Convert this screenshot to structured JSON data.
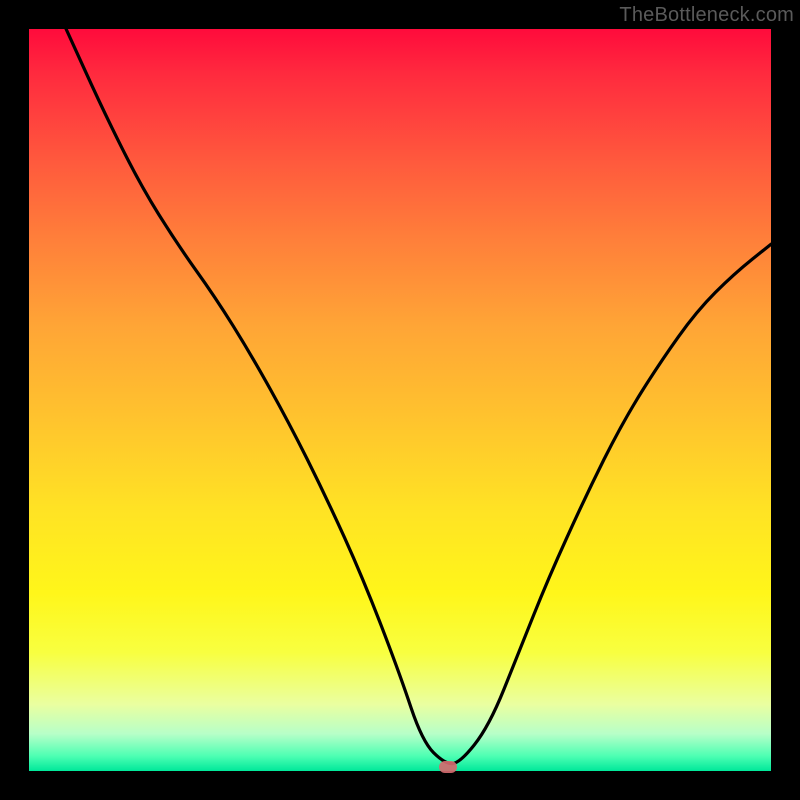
{
  "watermark": "TheBottleneck.com",
  "chart_data": {
    "type": "line",
    "title": "",
    "xlabel": "",
    "ylabel": "",
    "xlim": [
      0,
      1
    ],
    "ylim": [
      0,
      1
    ],
    "series": [
      {
        "name": "curve",
        "x": [
          0.05,
          0.1,
          0.15,
          0.2,
          0.25,
          0.3,
          0.35,
          0.4,
          0.45,
          0.5,
          0.53,
          0.56,
          0.58,
          0.62,
          0.66,
          0.7,
          0.75,
          0.8,
          0.85,
          0.9,
          0.95,
          1.0
        ],
        "y": [
          1.0,
          0.89,
          0.79,
          0.71,
          0.64,
          0.56,
          0.47,
          0.37,
          0.26,
          0.13,
          0.04,
          0.01,
          0.01,
          0.06,
          0.16,
          0.26,
          0.37,
          0.47,
          0.55,
          0.62,
          0.67,
          0.71
        ]
      }
    ],
    "marker": {
      "x": 0.565,
      "y": 0.005
    },
    "colors": {
      "curve": "#000000",
      "marker": "#d46a6f",
      "gradient_top": "#ff0b3c",
      "gradient_bottom": "#00e89a"
    }
  }
}
